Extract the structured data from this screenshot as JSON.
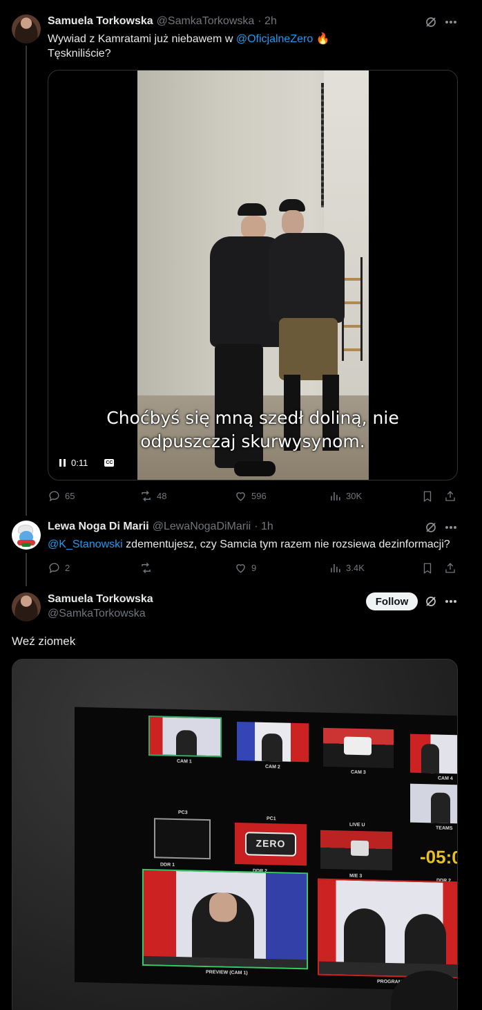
{
  "tweet1": {
    "author_name": "Samuela Torkowska",
    "author_handle": "@SamkaTorkowska",
    "time": "· 2h",
    "text_pre": "Wywiad z Kamratami już niebawem w ",
    "mention": "@OficjalneZero",
    "emoji": "🔥",
    "text_line2": "Tęskniliście?",
    "video": {
      "subtitle_line1": "Choćbyś się mną szedł doliną, nie",
      "subtitle_line2": "odpuszczaj skurwysynom.",
      "time": "0:11",
      "cc_label": "CC"
    },
    "stats": {
      "replies": "65",
      "reposts": "48",
      "likes": "596",
      "views": "30K"
    }
  },
  "tweet2": {
    "author_name": "Lewa Noga Di Marii",
    "author_handle": "@LewaNogaDiMarii",
    "time": "· 1h",
    "mention": "@K_Stanowski",
    "text": " zdementujesz, czy Samcia tym razem nie rozsiewa dezinformacji?",
    "stats": {
      "replies": "2",
      "reposts": "",
      "likes": "9",
      "views": "3.4K"
    }
  },
  "tweet3": {
    "author_name": "Samuela Torkowska",
    "author_handle": "@SamkaTorkowska",
    "follow_label": "Follow",
    "text": "Weź ziomek",
    "monitor": {
      "cam1": "CAM 1",
      "cam2": "CAM 2",
      "cam3": "CAM 3",
      "cam4": "CAM 4",
      "pc3": "PC3",
      "pc1": "PC1",
      "liveu": "LIVE U",
      "teams": "TEAMS",
      "ddr1": "DDR 1",
      "ddr2a": "DDR 2",
      "me3": "M/E 3",
      "ddr2b": "DDR 2",
      "timer": "-05:0",
      "preview": "PREVIEW (CAM 1)",
      "program": "PROGRAM (C",
      "logo": "ZERO"
    }
  },
  "colors": {
    "accent": "#1d9bf0",
    "muted": "#71767b",
    "bg": "#000000",
    "border": "#2f3336"
  }
}
